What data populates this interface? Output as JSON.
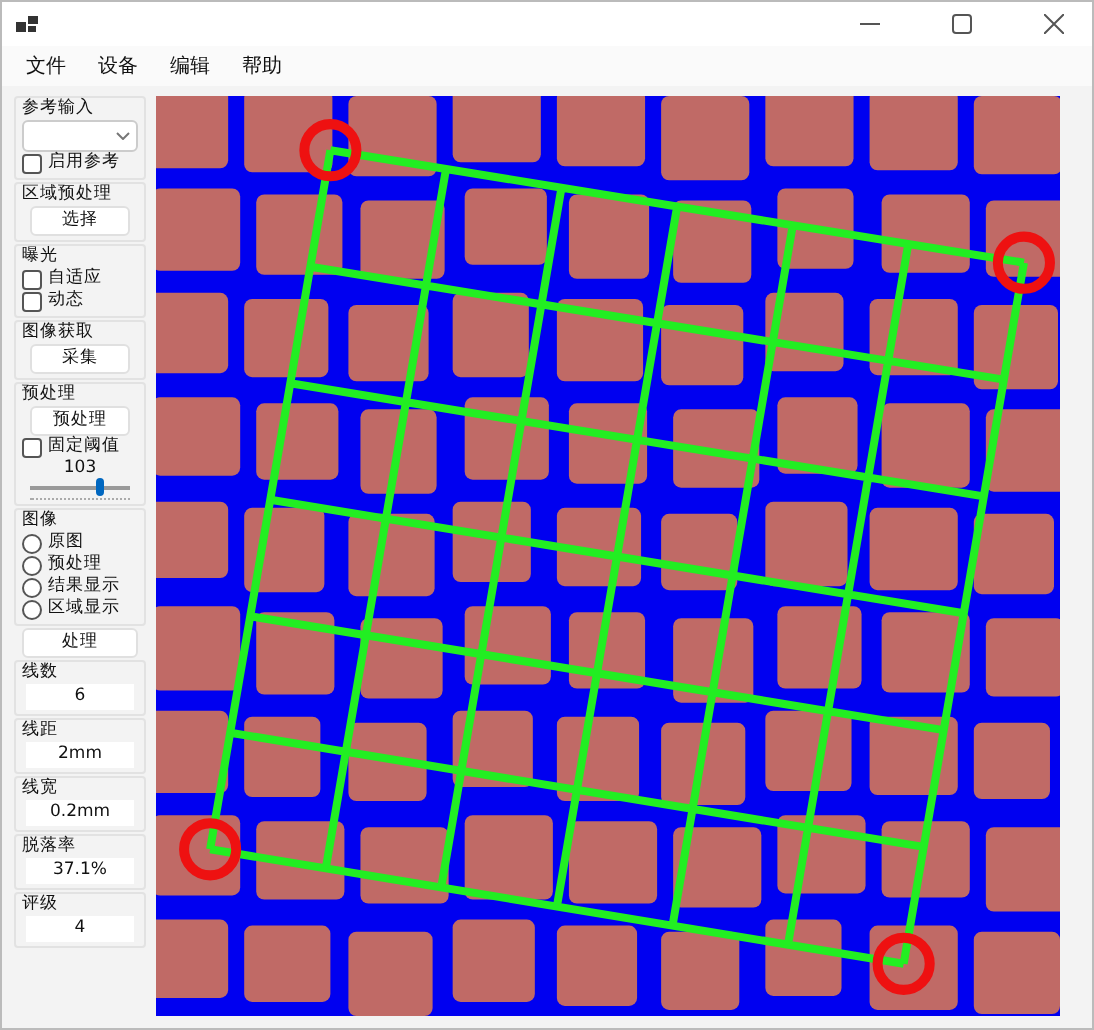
{
  "menu": [
    {
      "label": "文件"
    },
    {
      "label": "设备"
    },
    {
      "label": "编辑"
    },
    {
      "label": "帮助"
    }
  ],
  "sidebar": [
    {
      "kind": "group",
      "title": "参考输入",
      "items": [
        {
          "kind": "dropdown"
        },
        {
          "kind": "checkbox",
          "label": "启用参考",
          "checked": false
        }
      ]
    },
    {
      "kind": "group",
      "title": "区域预处理",
      "items": [
        {
          "kind": "button",
          "label": "选择"
        }
      ]
    },
    {
      "kind": "group",
      "title": "曝光",
      "items": [
        {
          "kind": "checkbox",
          "label": "自适应",
          "checked": false
        },
        {
          "kind": "checkbox",
          "label": "动态",
          "checked": false
        }
      ]
    },
    {
      "kind": "group",
      "title": "图像获取",
      "items": [
        {
          "kind": "button",
          "label": "采集"
        }
      ]
    },
    {
      "kind": "group",
      "title": "预处理",
      "items": [
        {
          "kind": "button",
          "label": "预处理"
        },
        {
          "kind": "checkbox",
          "label": "固定阈值",
          "checked": false
        },
        {
          "kind": "value",
          "label": "103"
        },
        {
          "kind": "slider",
          "level": 0.7
        }
      ]
    },
    {
      "kind": "group",
      "title": "图像",
      "items": [
        {
          "kind": "radio",
          "label": "原图",
          "selected": false
        },
        {
          "kind": "radio",
          "label": "预处理",
          "selected": false
        },
        {
          "kind": "radio",
          "label": "结果显示",
          "selected": false
        },
        {
          "kind": "radio",
          "label": "区域显示",
          "selected": false
        }
      ]
    },
    {
      "kind": "button",
      "label": "处理"
    },
    {
      "kind": "group",
      "title": "线数",
      "items": [
        {
          "kind": "field",
          "value": "6"
        }
      ]
    },
    {
      "kind": "group",
      "title": "线距",
      "items": [
        {
          "kind": "field",
          "value": "2mm"
        }
      ]
    },
    {
      "kind": "group",
      "title": "线宽",
      "items": [
        {
          "kind": "field",
          "value": "0.2mm"
        }
      ]
    },
    {
      "kind": "group",
      "title": "脱落率",
      "items": [
        {
          "kind": "field",
          "value": "37.1%"
        }
      ]
    },
    {
      "kind": "group",
      "title": "评级",
      "items": [
        {
          "kind": "field",
          "value": "4"
        }
      ]
    }
  ]
}
